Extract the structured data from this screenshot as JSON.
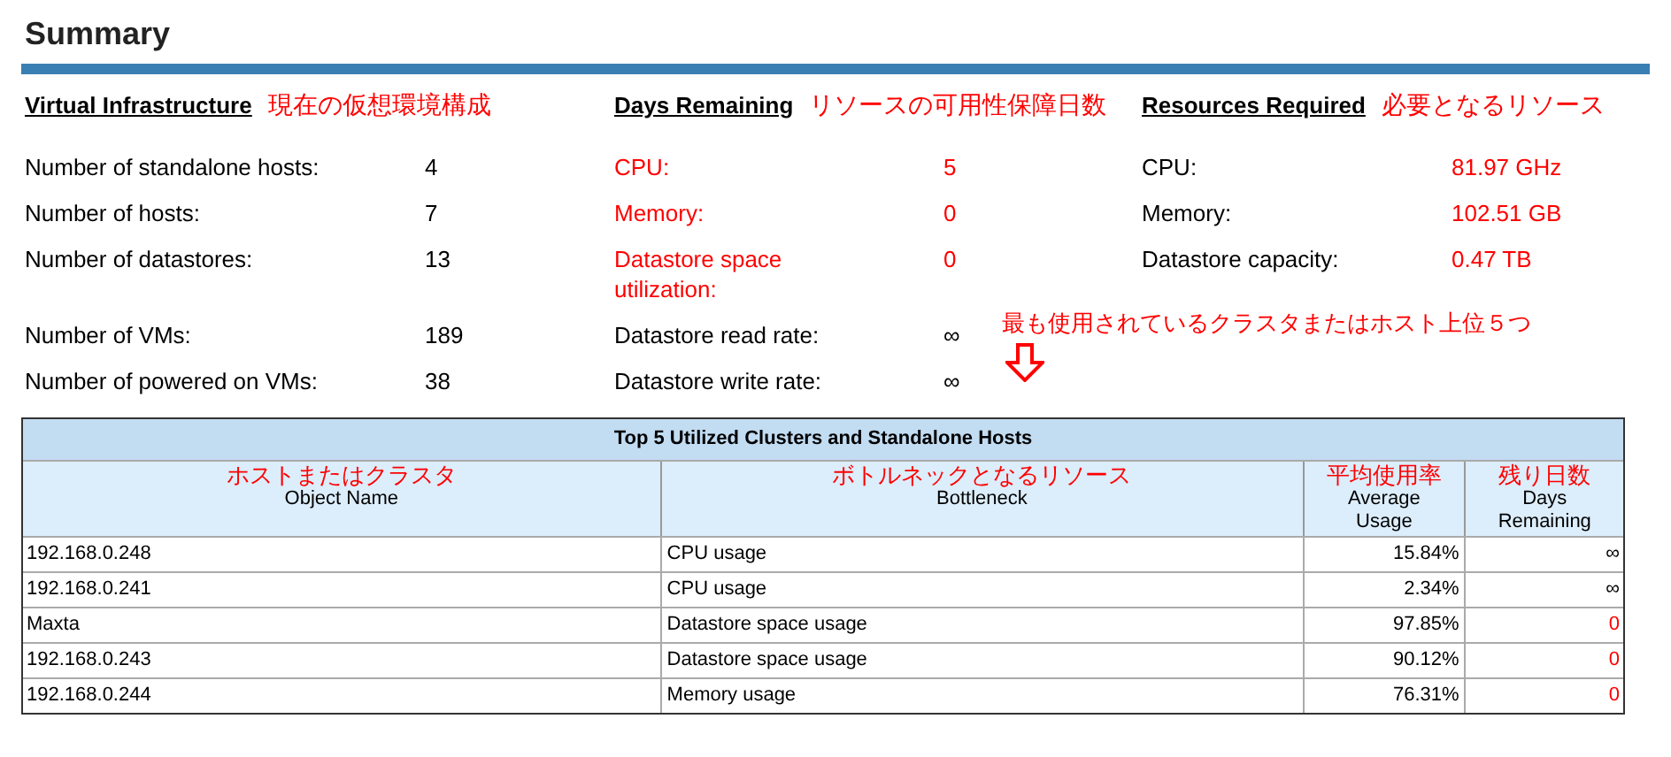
{
  "title": "Summary",
  "sections": [
    {
      "heading": "Virtual Infrastructure",
      "annotation": "現在の仮想環境構成",
      "items": [
        {
          "label": "Number of standalone hosts:",
          "value": "4",
          "label_alert": false,
          "alert": false
        },
        {
          "label": "Number of hosts:",
          "value": "7",
          "label_alert": false,
          "alert": false
        },
        {
          "label": "Number of datastores:",
          "value": "13",
          "label_alert": false,
          "alert": false
        },
        {
          "label": "Number of VMs:",
          "value": "189",
          "label_alert": false,
          "alert": false
        },
        {
          "label": "Number of powered on VMs:",
          "value": "38",
          "label_alert": false,
          "alert": false
        }
      ]
    },
    {
      "heading": "Days Remaining",
      "annotation": "リソースの可用性保障日数",
      "items": [
        {
          "label": "CPU:",
          "value": "5",
          "label_alert": true,
          "alert": true
        },
        {
          "label": "Memory:",
          "value": "0",
          "label_alert": true,
          "alert": true
        },
        {
          "label": "Datastore space utilization:",
          "value": "0",
          "label_alert": true,
          "alert": true
        },
        {
          "label": "Datastore read rate:",
          "value": "∞",
          "label_alert": false,
          "alert": false
        },
        {
          "label": "Datastore write rate:",
          "value": "∞",
          "label_alert": false,
          "alert": false
        }
      ]
    },
    {
      "heading": "Resources Required",
      "annotation": "必要となるリソース",
      "items": [
        {
          "label": "CPU:",
          "value": "81.97 GHz",
          "label_alert": false,
          "alert": true
        },
        {
          "label": "Memory:",
          "value": "102.51 GB",
          "label_alert": false,
          "alert": true
        },
        {
          "label": "Datastore capacity:",
          "value": "0.47 TB",
          "label_alert": false,
          "alert": true
        }
      ]
    }
  ],
  "callout": "最も使用されているクラスタまたはホスト上位５つ",
  "table": {
    "title": "Top 5 Utilized Clusters and Standalone Hosts",
    "columns": [
      {
        "annotation": "ホストまたはクラスタ",
        "label": "Object Name"
      },
      {
        "annotation": "ボトルネックとなるリソース",
        "label": "Bottleneck"
      },
      {
        "annotation": "平均使用率",
        "label": "Average Usage"
      },
      {
        "annotation": "残り日数",
        "label": "Days Remaining"
      }
    ],
    "rows": [
      {
        "object": "192.168.0.248",
        "bottleneck": "CPU usage",
        "usage": "15.84%",
        "days": "∞",
        "alert": false
      },
      {
        "object": "192.168.0.241",
        "bottleneck": "CPU usage",
        "usage": "2.34%",
        "days": "∞",
        "alert": false
      },
      {
        "object": "Maxta",
        "bottleneck": "Datastore space usage",
        "usage": "97.85%",
        "days": "0",
        "alert": true
      },
      {
        "object": "192.168.0.243",
        "bottleneck": "Datastore space usage",
        "usage": "90.12%",
        "days": "0",
        "alert": true
      },
      {
        "object": "192.168.0.244",
        "bottleneck": "Memory usage",
        "usage": "76.31%",
        "days": "0",
        "alert": true
      }
    ]
  }
}
